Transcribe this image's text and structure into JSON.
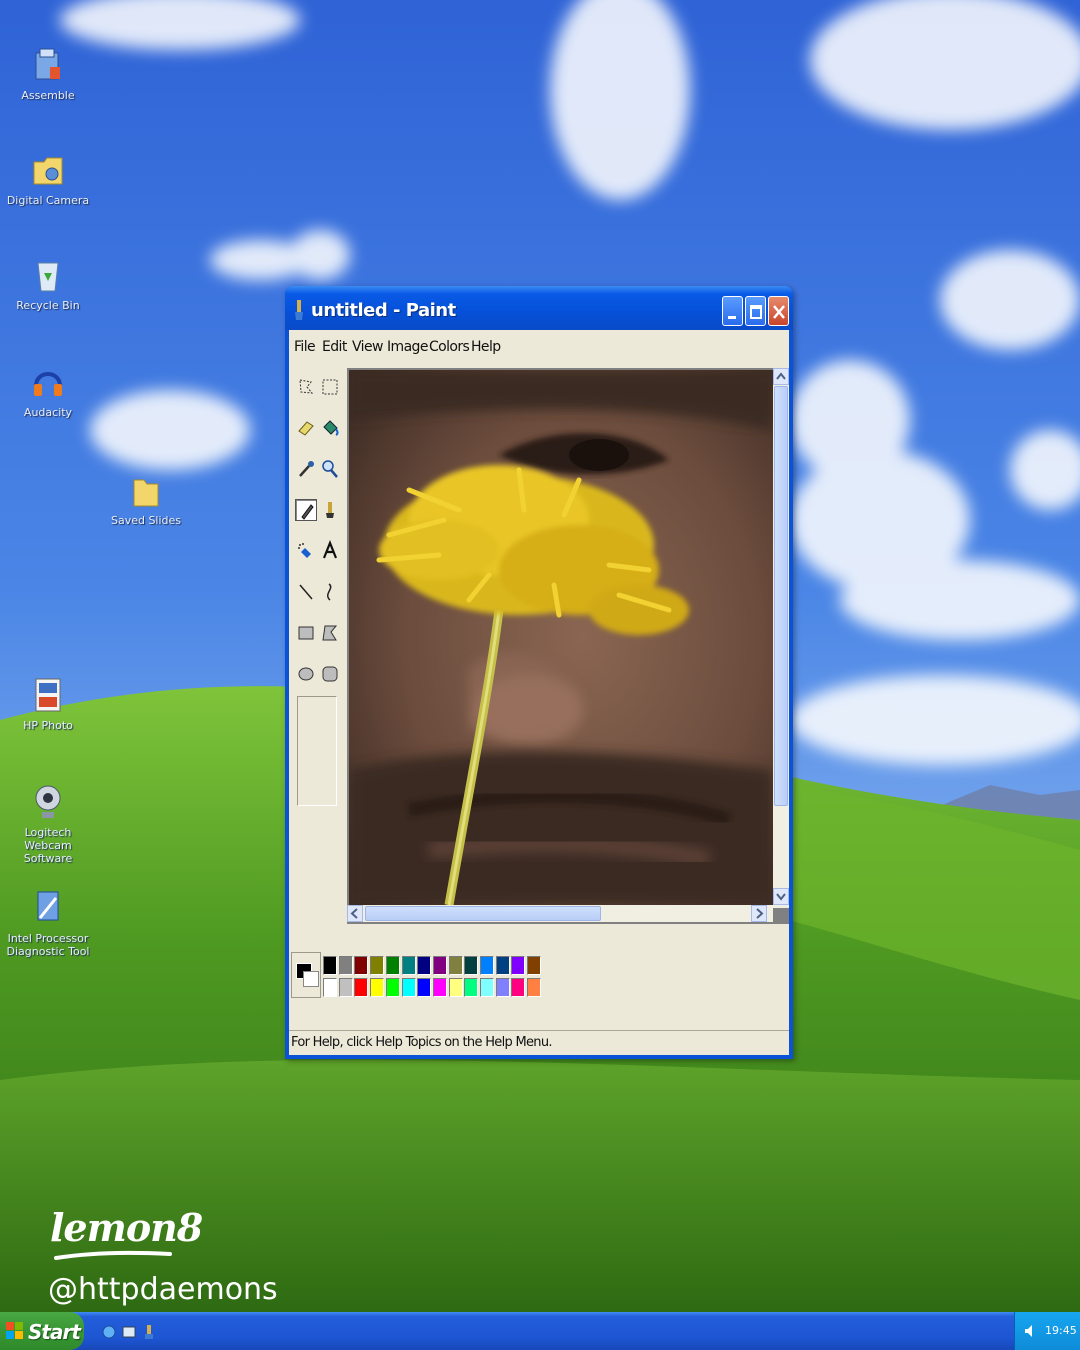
{
  "desktop": {
    "icons": [
      {
        "label": "Assemble"
      },
      {
        "label": "Digital Camera"
      },
      {
        "label": "Recycle Bin"
      },
      {
        "label": "Audacity"
      },
      {
        "label": "Saved Slides"
      },
      {
        "label": "HP Photo"
      },
      {
        "label": "Logitech Webcam Software"
      },
      {
        "label": "Intel Processor Diagnostic Tool"
      }
    ]
  },
  "paint": {
    "title": "untitled - Paint",
    "menu": [
      "File",
      "Edit",
      "View",
      "Image",
      "Colors",
      "Help"
    ],
    "status": "For Help, click Help Topics on the Help Menu.",
    "palette_top": [
      "#000000",
      "#808080",
      "#800000",
      "#808000",
      "#008000",
      "#008080",
      "#000080",
      "#800080",
      "#808040",
      "#004040",
      "#0080ff",
      "#004080",
      "#8000ff",
      "#804000"
    ],
    "palette_bottom": [
      "#ffffff",
      "#c0c0c0",
      "#ff0000",
      "#ffff00",
      "#00ff00",
      "#00ffff",
      "#0000ff",
      "#ff00ff",
      "#ffff80",
      "#00ff80",
      "#80ffff",
      "#8080ff",
      "#ff0080",
      "#ff8040"
    ]
  },
  "taskbar": {
    "start_label": "Start",
    "clock": "19:45"
  },
  "watermark": {
    "logo": "lemon8",
    "handle": "@httpdaemons"
  }
}
